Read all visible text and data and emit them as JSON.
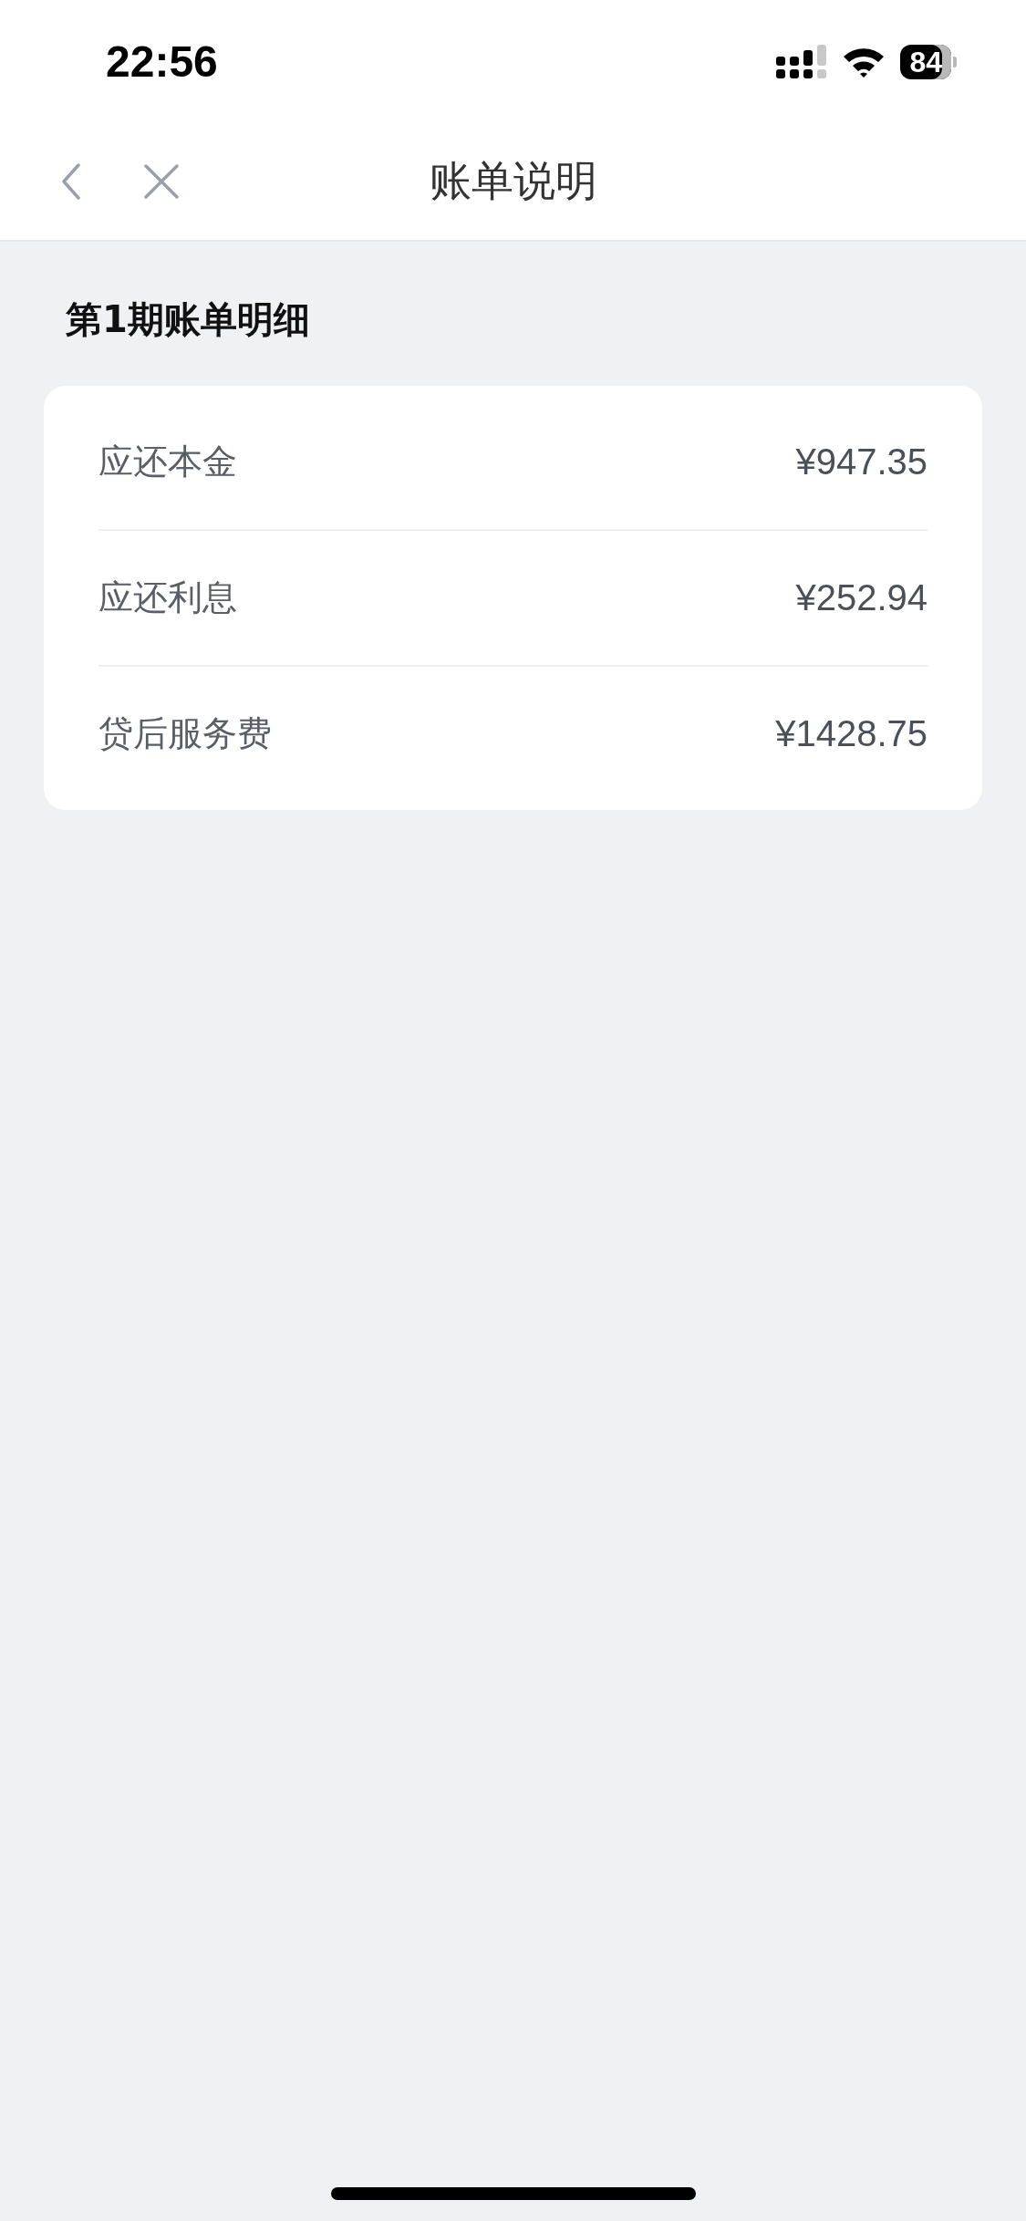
{
  "status_bar": {
    "time": "22:56",
    "battery": "84"
  },
  "nav_bar": {
    "title": "账单说明"
  },
  "section": {
    "title": "第1期账单明细",
    "rows": [
      {
        "label": "应还本金",
        "value": "¥947.35"
      },
      {
        "label": "应还利息",
        "value": "¥252.94"
      },
      {
        "label": "贷后服务费",
        "value": "¥1428.75"
      }
    ]
  }
}
